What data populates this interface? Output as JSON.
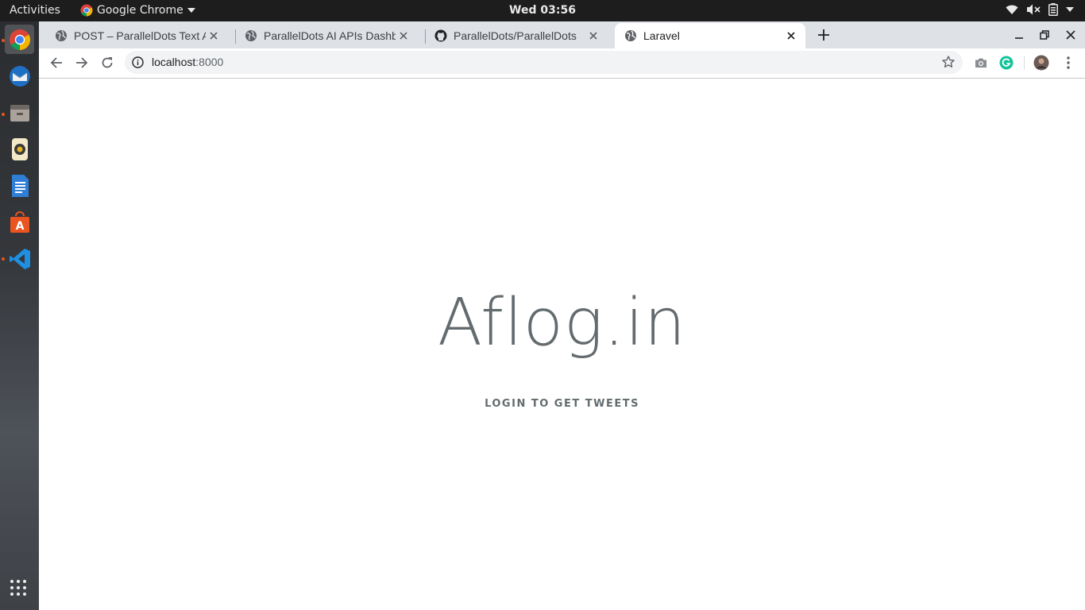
{
  "topbar": {
    "activities": "Activities",
    "app_name": "Google Chrome",
    "clock": "Wed 03:56"
  },
  "dock": {
    "items": [
      "chrome-icon",
      "thunderbird-icon",
      "files-icon",
      "rhythmbox-icon",
      "writer-icon",
      "software-icon",
      "vscode-icon"
    ],
    "show_apps": "apps-grid-icon"
  },
  "tabs": [
    {
      "title": "POST – ParallelDots Text A",
      "favicon": "globe-icon"
    },
    {
      "title": "ParallelDots AI APIs Dashb",
      "favicon": "globe-icon"
    },
    {
      "title": "ParallelDots/ParallelDots",
      "favicon": "github-icon"
    },
    {
      "title": "Laravel",
      "favicon": "globe-icon",
      "active": true
    }
  ],
  "address": {
    "host": "localhost",
    "port": ":8000"
  },
  "page": {
    "title": "Aflog.in",
    "link": "LOGIN TO GET TWEETS"
  },
  "colors": {
    "accent": "#e95420",
    "text": "#636b6f",
    "tabstrip": "#dee1e6"
  }
}
